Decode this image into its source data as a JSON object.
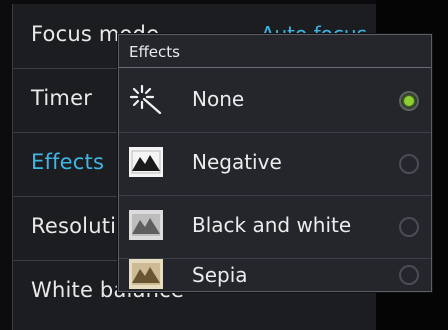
{
  "settings": {
    "rows": [
      {
        "label": "Focus mode",
        "value": "Auto focus"
      },
      {
        "label": "Timer",
        "value": ""
      },
      {
        "label": "Effects",
        "value": ""
      },
      {
        "label": "Resolution",
        "value": ""
      },
      {
        "label": "White balance",
        "value": ""
      }
    ]
  },
  "dialog": {
    "title": "Effects",
    "options": [
      {
        "label": "None",
        "icon": "sparkle-icon",
        "selected": true
      },
      {
        "label": "Negative",
        "icon": "negative-effect-icon",
        "selected": false
      },
      {
        "label": "Black and white",
        "icon": "black-and-white-effect-icon",
        "selected": false
      },
      {
        "label": "Sepia",
        "icon": "sepia-effect-icon",
        "selected": false
      }
    ]
  },
  "colors": {
    "accent": "#3fb5e3",
    "radio_selected": "#8bd12f",
    "background": "#1c1d21"
  }
}
